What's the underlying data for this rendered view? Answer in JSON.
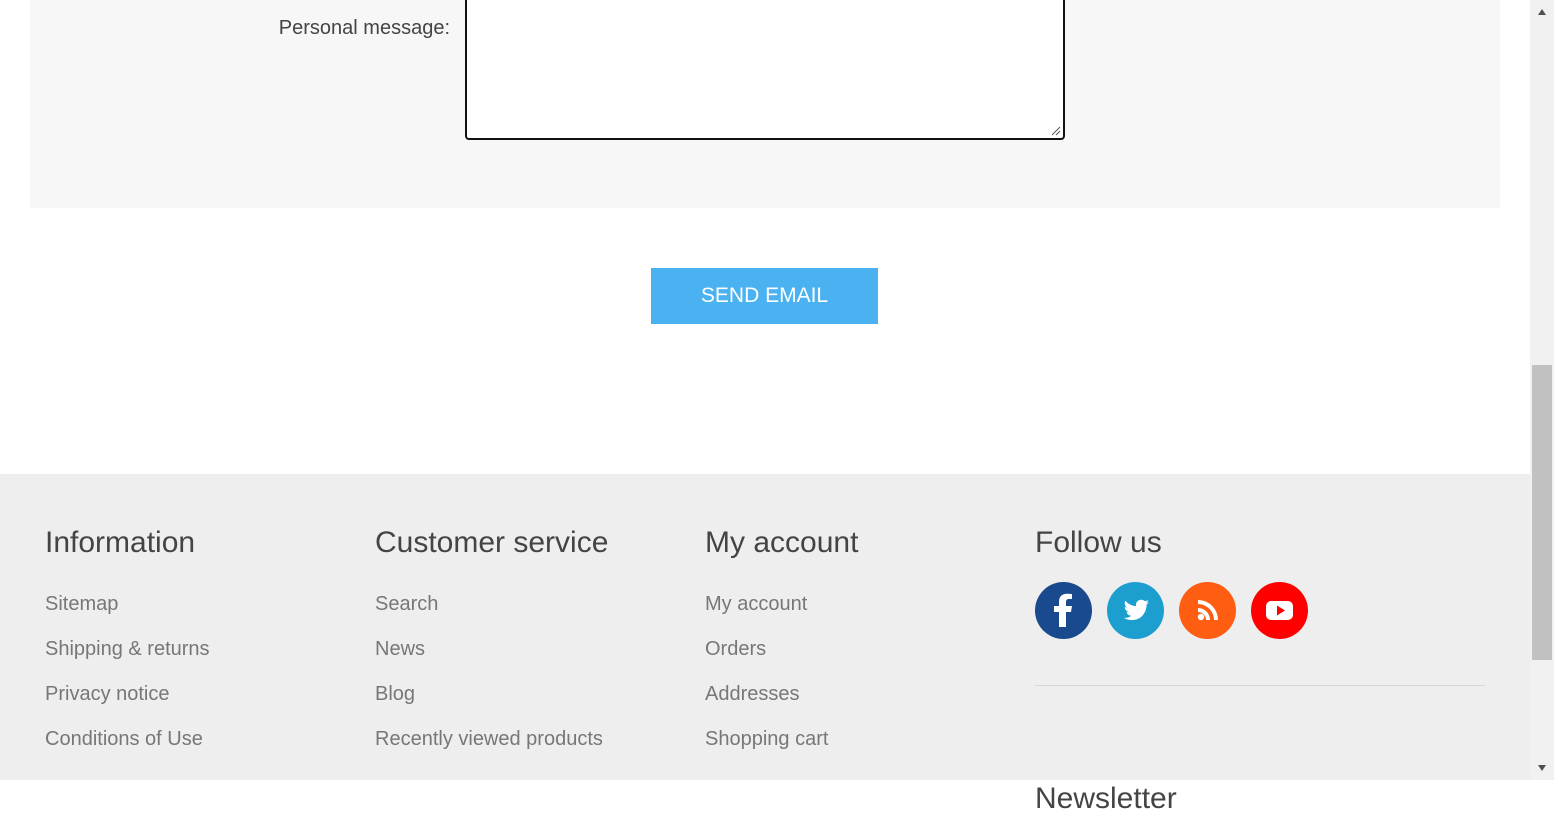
{
  "form": {
    "personal_message_label": "Personal message:",
    "personal_message_value": ""
  },
  "send_button": {
    "label": "SEND EMAIL",
    "color": "#4ab2f1"
  },
  "footer": {
    "information": {
      "title": "Information",
      "items": [
        "Sitemap",
        "Shipping & returns",
        "Privacy notice",
        "Conditions of Use"
      ]
    },
    "customer_service": {
      "title": "Customer service",
      "items": [
        "Search",
        "News",
        "Blog",
        "Recently viewed products"
      ]
    },
    "my_account": {
      "title": "My account",
      "items": [
        "My account",
        "Orders",
        "Addresses",
        "Shopping cart"
      ]
    },
    "follow_us": {
      "title": "Follow us",
      "icons": [
        {
          "name": "facebook-icon",
          "color": "#194a8d"
        },
        {
          "name": "twitter-icon",
          "color": "#1c9fcf"
        },
        {
          "name": "rss-icon",
          "color": "#fe5d12"
        },
        {
          "name": "youtube-icon",
          "color": "#ff0000"
        }
      ]
    },
    "newsletter": {
      "title": "Newsletter"
    }
  }
}
